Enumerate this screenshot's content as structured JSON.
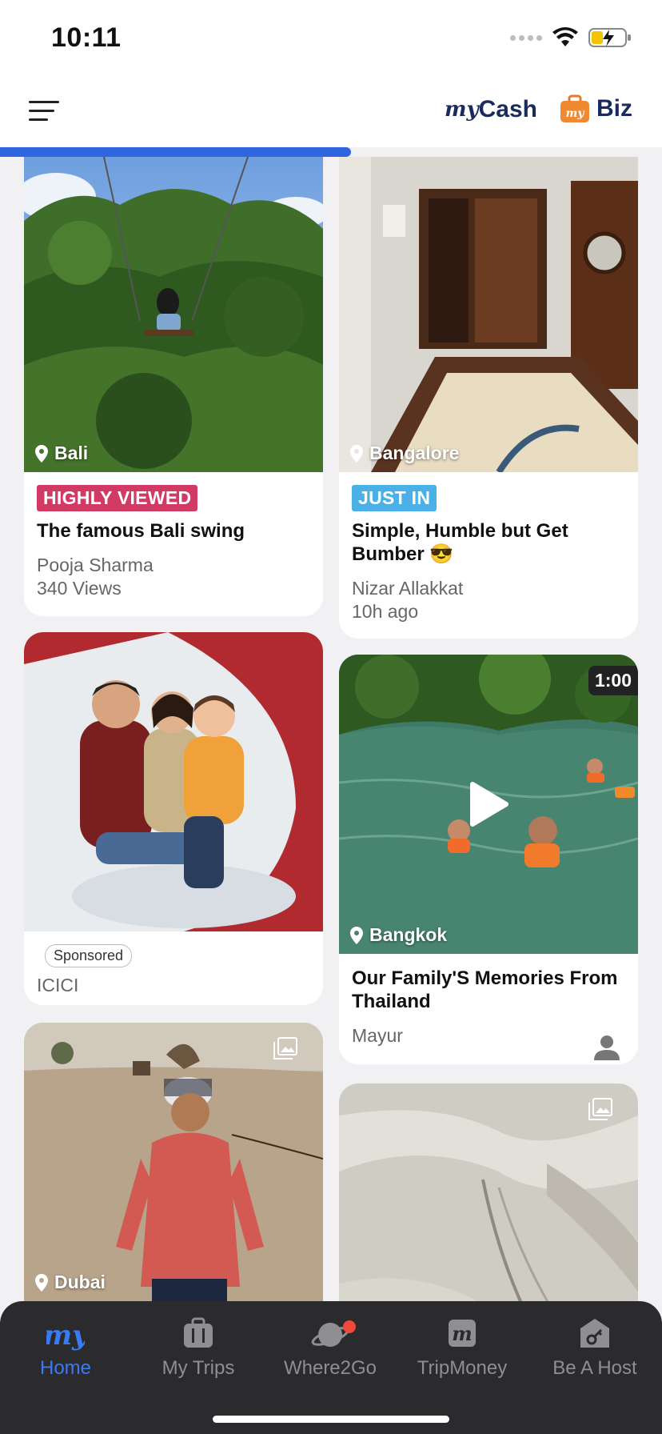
{
  "status_bar": {
    "time": "10:11"
  },
  "header": {
    "mycash_logo": "my",
    "mycash_label": "Cash",
    "biz_label": "Biz"
  },
  "progress": {
    "fraction": 0.53
  },
  "cards": {
    "bali": {
      "location": "Bali",
      "badge": "HIGHLY VIEWED",
      "title": "The famous Bali swing",
      "author": "Pooja Sharma",
      "stat": "340 Views"
    },
    "bangalore": {
      "location": "Bangalore",
      "badge": "JUST IN",
      "title": "Simple, Humble but Get Bumber 😎",
      "author": "Nizar Allakkat",
      "stat": "10h ago"
    },
    "icici": {
      "sponsored": "Sponsored",
      "advertiser": "ICICI"
    },
    "bangkok": {
      "duration": "1:00",
      "location": "Bangkok",
      "title": "Our Family'S Memories From Thailand",
      "author": "Mayur"
    },
    "dubai": {
      "location": "Dubai"
    }
  },
  "tabbar": {
    "home": "Home",
    "trips": "My Trips",
    "where2go": "Where2Go",
    "tripmoney": "TripMoney",
    "host": "Be A Host"
  },
  "colors": {
    "accent": "#3a7bf2",
    "progress": "#2f66e0",
    "badge_red": "#d13a63",
    "badge_blue": "#4ab0e6"
  }
}
